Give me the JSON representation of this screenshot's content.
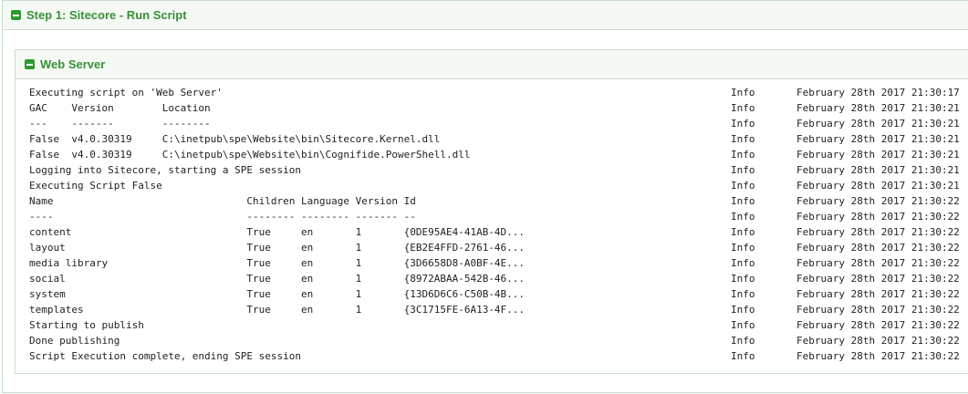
{
  "step": {
    "title": "Step 1: Sitecore - Run Script"
  },
  "server": {
    "title": "Web Server"
  },
  "log": [
    {
      "message": "Executing script on 'Web Server'",
      "level": "Info",
      "time": "February 28th 2017 21:30:17"
    },
    {
      "message": "GAC    Version        Location",
      "level": "Info",
      "time": "February 28th 2017 21:30:21"
    },
    {
      "message": "---    -------        --------",
      "level": "Info",
      "time": "February 28th 2017 21:30:21"
    },
    {
      "message": "False  v4.0.30319     C:\\inetpub\\spe\\Website\\bin\\Sitecore.Kernel.dll",
      "level": "Info",
      "time": "February 28th 2017 21:30:21"
    },
    {
      "message": "False  v4.0.30319     C:\\inetpub\\spe\\Website\\bin\\Cognifide.PowerShell.dll",
      "level": "Info",
      "time": "February 28th 2017 21:30:21"
    },
    {
      "message": "Logging into Sitecore, starting a SPE session",
      "level": "Info",
      "time": "February 28th 2017 21:30:21"
    },
    {
      "message": "Executing Script False",
      "level": "Info",
      "time": "February 28th 2017 21:30:21"
    },
    {
      "message": "Name                                Children Language Version Id",
      "level": "Info",
      "time": "February 28th 2017 21:30:22"
    },
    {
      "message": "----                                -------- -------- ------- --",
      "level": "Info",
      "time": "February 28th 2017 21:30:22"
    },
    {
      "message": "content                             True     en       1       {0DE95AE4-41AB-4D...",
      "level": "Info",
      "time": "February 28th 2017 21:30:22"
    },
    {
      "message": "layout                              True     en       1       {EB2E4FFD-2761-46...",
      "level": "Info",
      "time": "February 28th 2017 21:30:22"
    },
    {
      "message": "media library                       True     en       1       {3D6658D8-A0BF-4E...",
      "level": "Info",
      "time": "February 28th 2017 21:30:22"
    },
    {
      "message": "social                              True     en       1       {8972ABAA-542B-46...",
      "level": "Info",
      "time": "February 28th 2017 21:30:22"
    },
    {
      "message": "system                              True     en       1       {13D6D6C6-C50B-4B...",
      "level": "Info",
      "time": "February 28th 2017 21:30:22"
    },
    {
      "message": "templates                           True     en       1       {3C1715FE-6A13-4F...",
      "level": "Info",
      "time": "February 28th 2017 21:30:22"
    },
    {
      "message": "Starting to publish",
      "level": "Info",
      "time": "February 28th 2017 21:30:22"
    },
    {
      "message": "Done publishing",
      "level": "Info",
      "time": "February 28th 2017 21:30:22"
    },
    {
      "message": "Script Execution complete, ending SPE session",
      "level": "Info",
      "time": "February 28th 2017 21:30:22"
    }
  ]
}
